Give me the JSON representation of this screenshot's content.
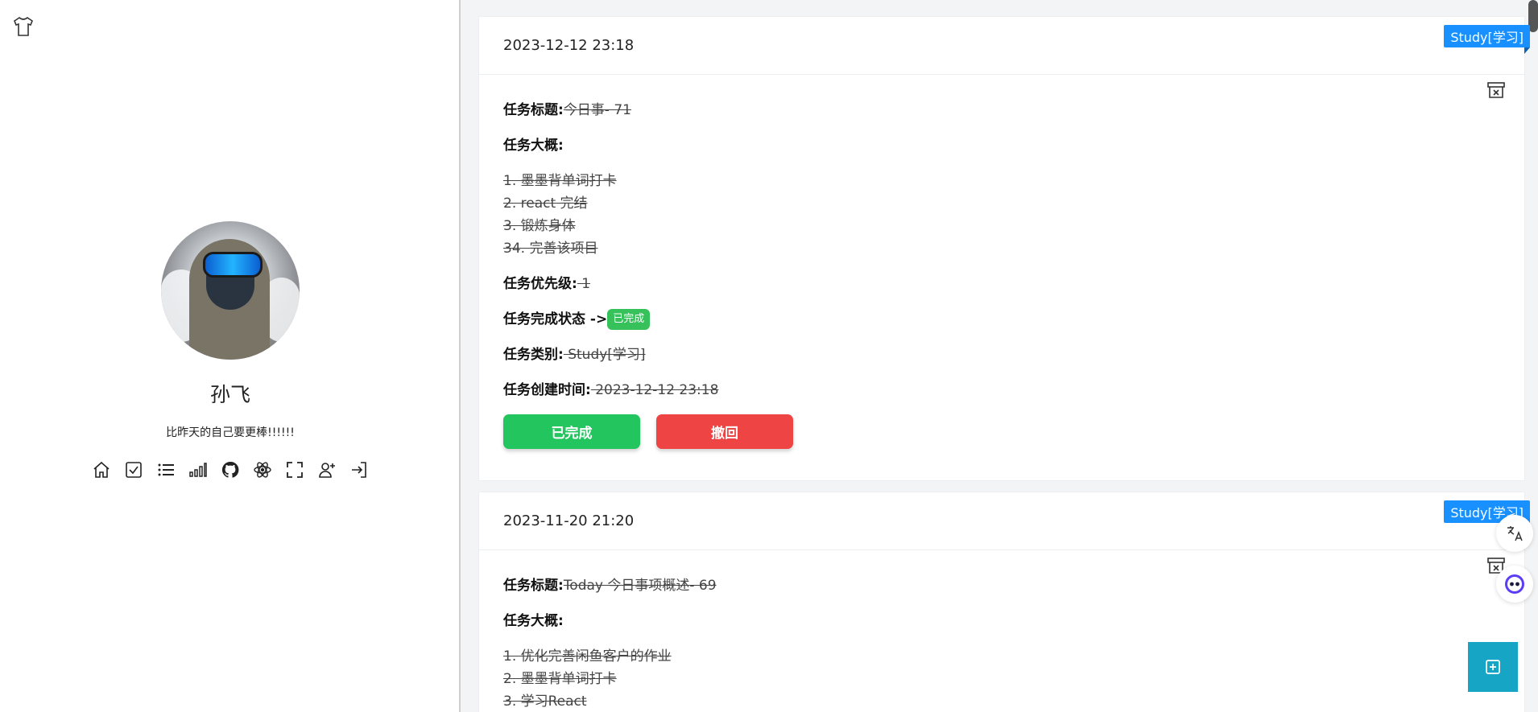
{
  "profile": {
    "name": "孙飞",
    "motto": "比昨天的自己要更棒!!!!!!",
    "icons": [
      "home-icon",
      "todo-check-icon",
      "list-icon",
      "signal-bars-icon",
      "github-icon",
      "settings-atom-icon",
      "fullscreen-icon",
      "add-user-icon",
      "logout-icon"
    ]
  },
  "tasks": [
    {
      "date": "2023-12-12 23:18",
      "category_badge": "Study[学习]",
      "title_label": "任务标题:",
      "title": "今日事- 71",
      "summary_label": "任务大概:",
      "summary_items": [
        "1. 墨墨背单词打卡",
        "2. react 完结",
        "3. 锻炼身体",
        "34. 完善该项目"
      ],
      "priority_label": "任务优先级:",
      "priority": " 1",
      "status_label": "任务完成状态 ->",
      "status": "已完成",
      "category_label": "任务类别:",
      "category": " Study[学习]",
      "created_label": "任务创建时间:",
      "created": " 2023-12-12 23:18",
      "done_button": "已完成",
      "undo_button": "撤回"
    },
    {
      "date": "2023-11-20 21:20",
      "category_badge": "Study[学习]",
      "title_label": "任务标题:",
      "title": "Today 今日事项概述- 69",
      "summary_label": "任务大概:",
      "summary_items": [
        "1. 优化完善闲鱼客户的作业",
        "2. 墨墨背单词打卡",
        "3. 学习React"
      ]
    }
  ],
  "colors": {
    "badge": "#1890ff",
    "done": "#22c55e",
    "undo": "#ef4444",
    "add": "#17a5c6",
    "status": "#37c15a"
  }
}
